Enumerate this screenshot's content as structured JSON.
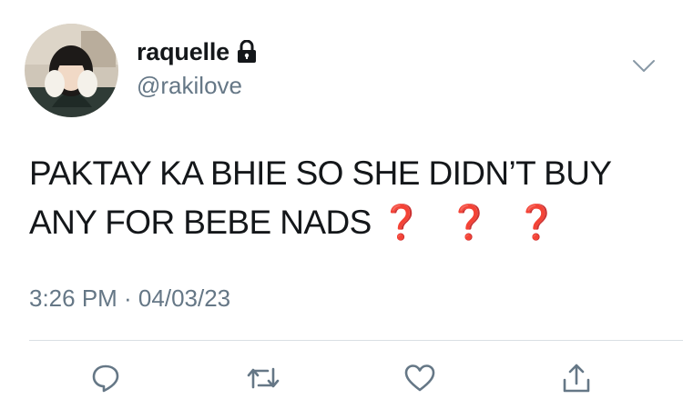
{
  "user": {
    "display_name": "raquelle",
    "handle": "@rakilove",
    "protected": true
  },
  "tweet": {
    "text": "PAKTAY KA BHIE SO SHE DIDN’T BUY ANY FOR BEBE NADS",
    "emoji": "❓ ❓ ❓",
    "timestamp": "3:26 PM · 04/03/23"
  },
  "actions": {
    "icons": [
      "reply-icon",
      "retweet-icon",
      "like-icon",
      "share-icon"
    ]
  },
  "colors": {
    "text": "#14171a",
    "secondary": "#657786",
    "divider": "#d9dfe4",
    "question_mark": "#dd2e44"
  }
}
